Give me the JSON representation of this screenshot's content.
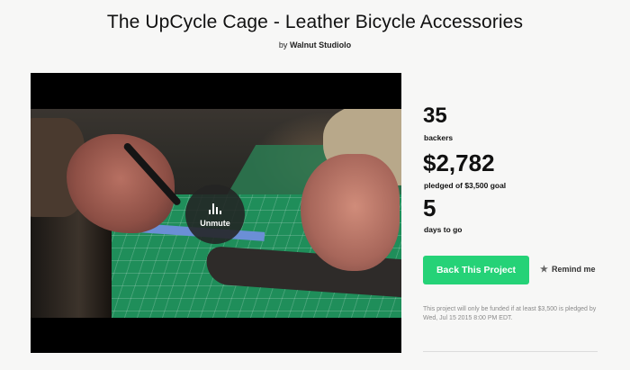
{
  "project": {
    "title": "The UpCycle Cage - Leather Bicycle Accessories",
    "by_prefix": "by",
    "creator": "Walnut Studiolo"
  },
  "video": {
    "unmute_label": "Unmute",
    "icon": "sound-bars-icon"
  },
  "stats": {
    "backers_count": "35",
    "backers_label": "backers",
    "pledged_amount": "$2,782",
    "pledged_label": "pledged of $3,500 goal",
    "days_count": "5",
    "days_label": "days to go"
  },
  "actions": {
    "back_label": "Back This Project",
    "remind_label": "Remind me",
    "remind_icon": "star-icon"
  },
  "fine_print": "This project will only be funded if at least $3,500 is pledged by Wed, Jul 15 2015 8:00 PM EDT.",
  "colors": {
    "accent": "#25d277",
    "background": "#f7f7f6",
    "text": "#111111"
  }
}
